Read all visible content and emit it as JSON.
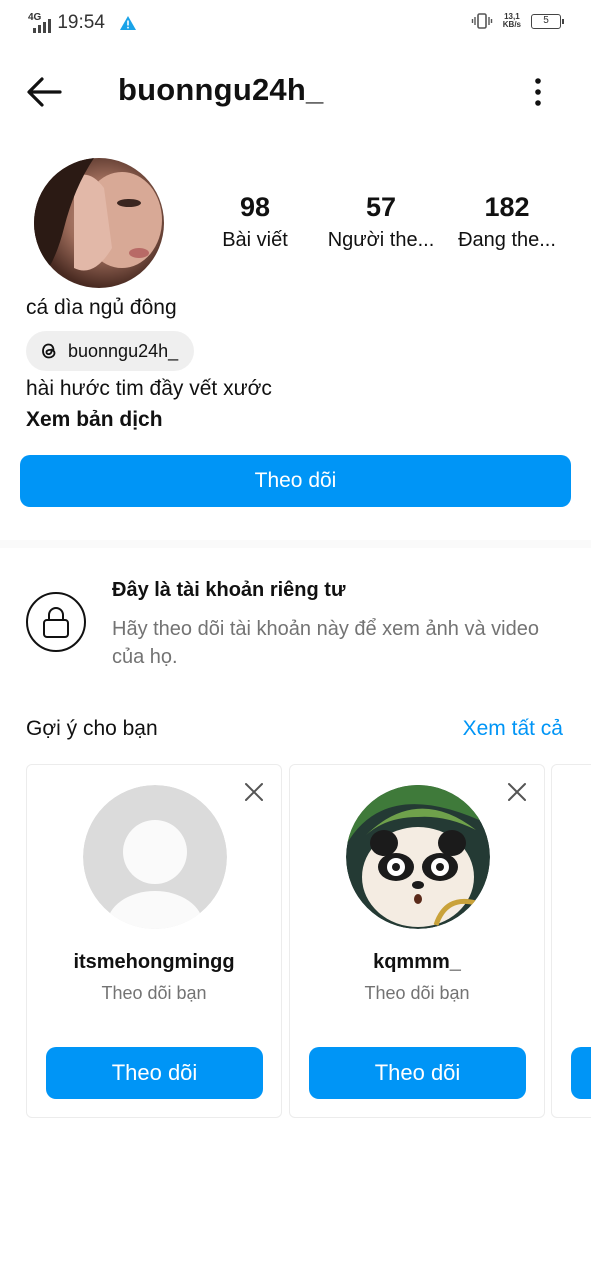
{
  "status_bar": {
    "network": "4G",
    "time": "19:54",
    "speed_value": "13,1",
    "speed_unit": "KB/s",
    "battery": "5"
  },
  "header": {
    "username": "buonngu24h_"
  },
  "profile": {
    "stats": [
      {
        "value": "98",
        "label": "Bài viết"
      },
      {
        "value": "57",
        "label": "Người the..."
      },
      {
        "value": "182",
        "label": "Đang the..."
      }
    ],
    "display_name": "cá dìa ngủ đông",
    "threads_handle": "buonngu24h_",
    "bio": "hài hước tim đầy vết xước",
    "translate_label": "Xem bản dịch",
    "follow_label": "Theo dõi"
  },
  "private_notice": {
    "title": "Đây là tài khoản riêng tư",
    "description": "Hãy theo dõi tài khoản này để xem ảnh và video của họ."
  },
  "suggestions": {
    "title": "Gợi ý cho bạn",
    "see_all": "Xem tất cả",
    "cards": [
      {
        "username": "itsmehongmingg",
        "subtitle": "Theo dõi bạn",
        "button": "Theo dõi"
      },
      {
        "username": "kqmmm_",
        "subtitle": "Theo dõi bạn",
        "button": "Theo dõi"
      }
    ]
  },
  "colors": {
    "accent": "#0095f6",
    "secondary_text": "#737373"
  }
}
